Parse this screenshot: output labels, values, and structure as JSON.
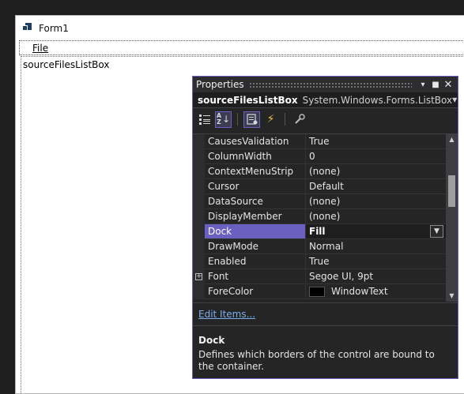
{
  "form": {
    "title": "Form1",
    "menu_file": "File",
    "listbox_name": "sourceFilesListBox"
  },
  "properties": {
    "title": "Properties",
    "object_name": "sourceFilesListBox",
    "object_type": "System.Windows.Forms.ListBox",
    "rows": [
      {
        "name": "CausesValidation",
        "value": "True"
      },
      {
        "name": "ColumnWidth",
        "value": "0"
      },
      {
        "name": "ContextMenuStrip",
        "value": "(none)"
      },
      {
        "name": "Cursor",
        "value": "Default"
      },
      {
        "name": "DataSource",
        "value": "(none)"
      },
      {
        "name": "DisplayMember",
        "value": "(none)"
      },
      {
        "name": "Dock",
        "value": "Fill"
      },
      {
        "name": "DrawMode",
        "value": "Normal"
      },
      {
        "name": "Enabled",
        "value": "True"
      },
      {
        "name": "Font",
        "value": "Segoe UI, 9pt"
      },
      {
        "name": "ForeColor",
        "value": "WindowText"
      }
    ],
    "command_link": "Edit Items...",
    "description_title": "Dock",
    "description_text": "Defines which borders of the control are bound to the container."
  },
  "colors": {
    "accent": "#6b5fbf",
    "panel_bg": "#252526",
    "link": "#7aaeee"
  },
  "icons": [
    "form-icon",
    "categorized-icon",
    "alphabetical-icon",
    "properties-icon",
    "events-icon",
    "property-pages-icon",
    "pin-icon",
    "maximize-icon",
    "close-icon",
    "expand-icon",
    "chevron-down-icon"
  ]
}
